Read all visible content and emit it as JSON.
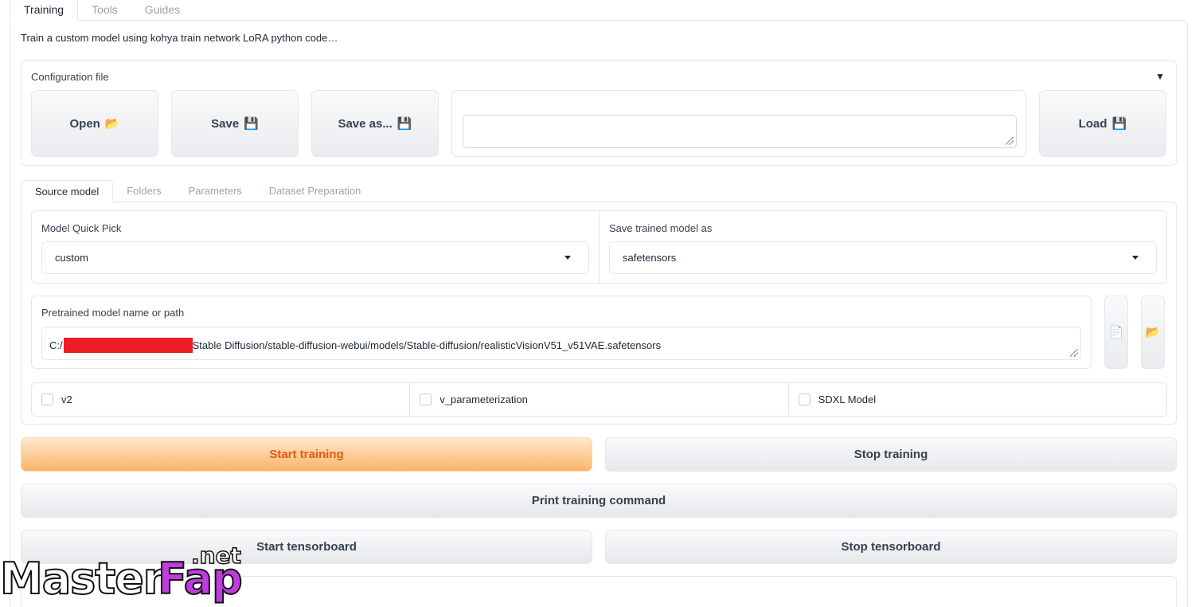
{
  "top_tabs": [
    "Training",
    "Tools",
    "Guides"
  ],
  "description": "Train a custom model using kohya train network LoRA python code…",
  "config": {
    "label": "Configuration file",
    "open_label": "Open",
    "open_icon": "folder-icon",
    "save_label": "Save",
    "save_icon": "floppy-disk-icon",
    "save_as_label": "Save as...",
    "load_label": "Load",
    "file_path_value": ""
  },
  "inner_tabs": [
    "Source model",
    "Folders",
    "Parameters",
    "Dataset Preparation"
  ],
  "model_quick_pick": {
    "label": "Model Quick Pick",
    "value": "custom"
  },
  "save_model_as": {
    "label": "Save trained model as",
    "value": "safetensors"
  },
  "pretrained": {
    "label": "Pretrained model name or path",
    "value_prefix": "C:/",
    "value_suffix": "Stable Diffusion/stable-diffusion-webui/models/Stable-diffusion/realisticVisionV51_v51VAE.safetensors"
  },
  "checkboxes": [
    {
      "label": "v2",
      "checked": false
    },
    {
      "label": "v_parameterization",
      "checked": false
    },
    {
      "label": "SDXL Model",
      "checked": false
    }
  ],
  "actions": {
    "start_training": "Start training",
    "stop_training": "Stop training",
    "print_command": "Print training command",
    "start_tensorboard": "Start tensorboard",
    "stop_tensorboard": "Stop tensorboard"
  },
  "watermark": {
    "part1": "Master",
    "part2": "Fap",
    "part3": ".net"
  },
  "colors": {
    "accent": "#ea580c",
    "primary_button": "#fbb46a",
    "watermark_pink": "#c03ce0"
  }
}
